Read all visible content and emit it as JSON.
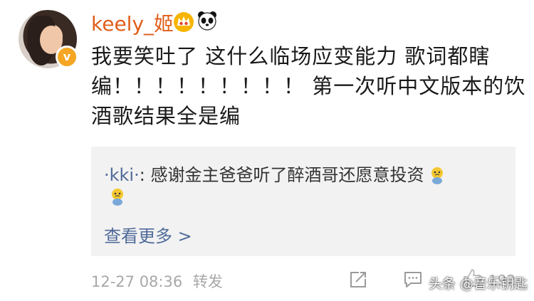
{
  "user": {
    "name": "keely_姬",
    "verified_mark": "v"
  },
  "post": {
    "lines": [
      "我要笑吐了 这什么临场应变能力 歌词都瞎",
      "编！！！！！！！！！ 第一次听中文版本的饮",
      "酒歌结果全是编"
    ]
  },
  "reply": {
    "author": "·kki·",
    "separator": ": ",
    "text": "感谢金主爸爸听了醉酒哥还愿意投资",
    "view_more": "查看更多 >"
  },
  "meta": {
    "timestamp": "12-27 08:36",
    "repost_label": "转发",
    "like_count": "192"
  },
  "watermark": "头条 @音乐钥匙",
  "colors": {
    "username": "#e05e1a",
    "link": "#506b9a",
    "badge": "#f5a623",
    "reply_bg": "#f2f2f2",
    "meta": "#a8a8a8"
  },
  "icons": [
    "crown-icon",
    "panda-icon",
    "crying-emoji-icon",
    "share-icon",
    "comment-icon",
    "like-icon"
  ]
}
